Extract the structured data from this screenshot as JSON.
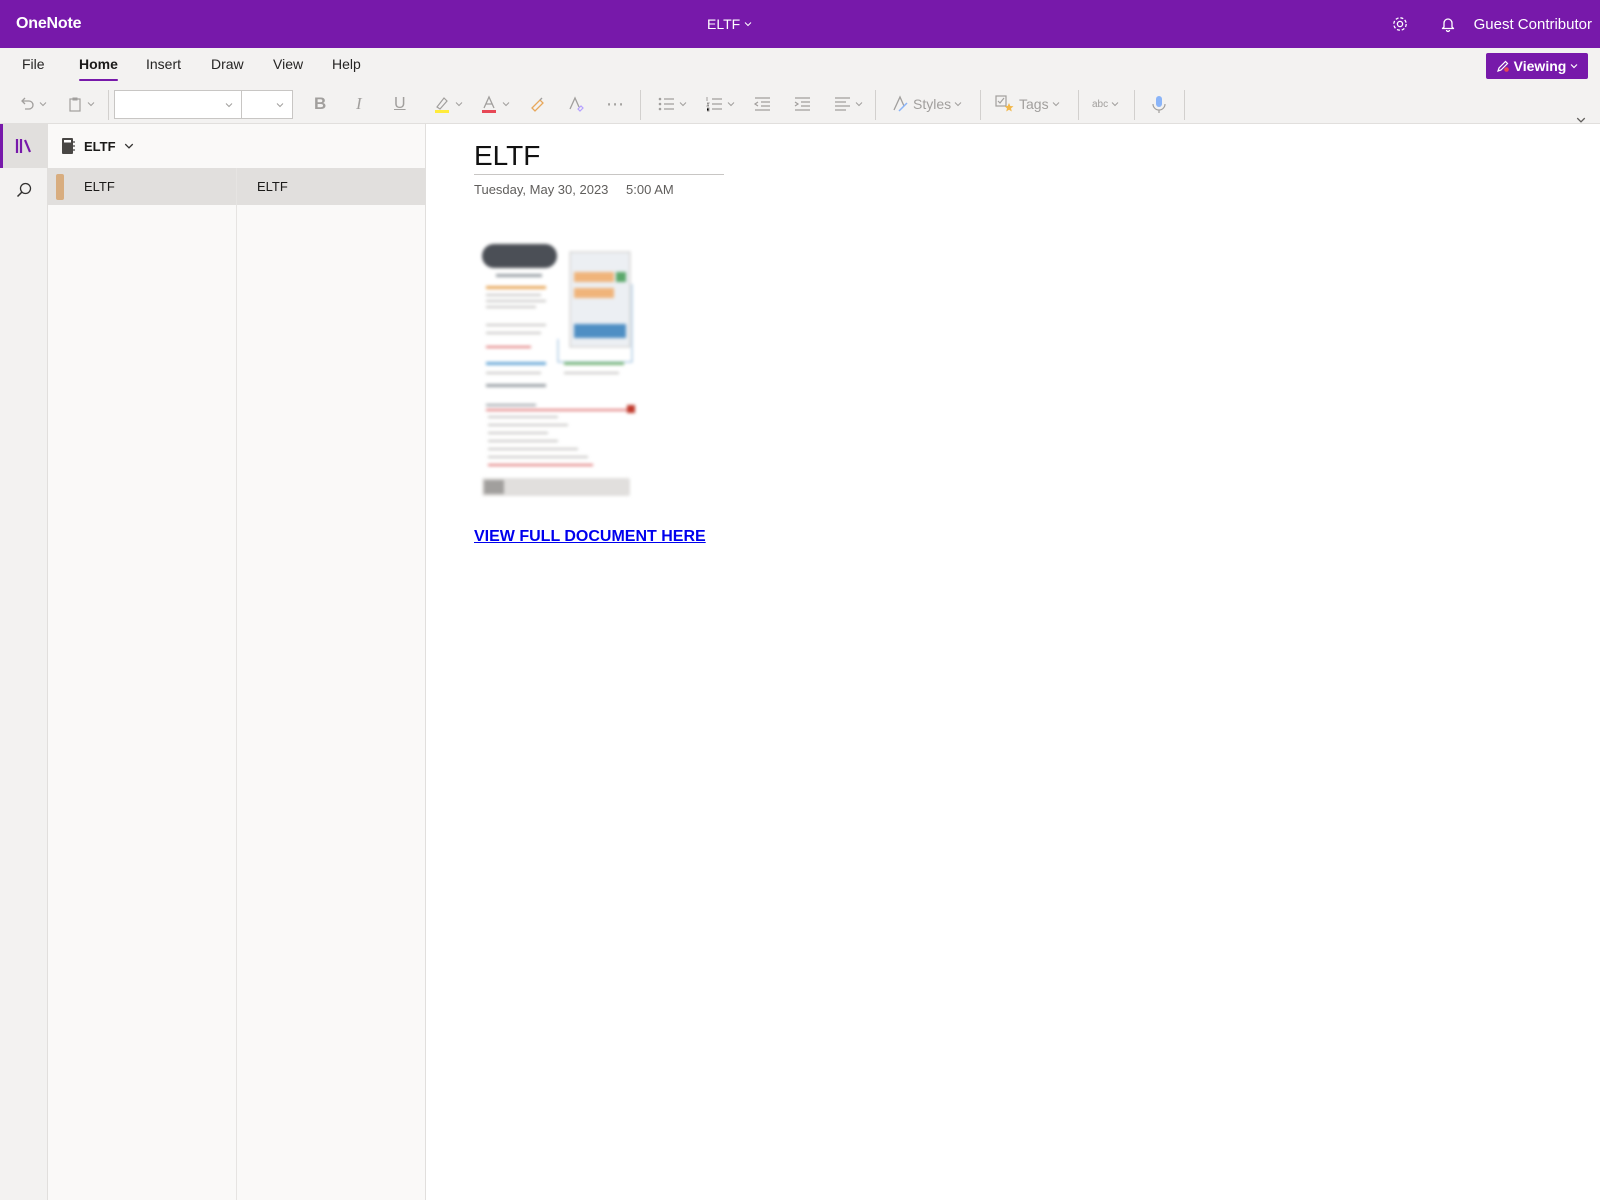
{
  "titlebar": {
    "app_name": "OneNote",
    "document_title": "ELTF",
    "user_name": "Guest Contributor",
    "icons": [
      "settings-icon",
      "notification-bell-icon"
    ]
  },
  "ribbon": {
    "tabs": [
      {
        "label": "File",
        "active": false
      },
      {
        "label": "Home",
        "active": true
      },
      {
        "label": "Insert",
        "active": false
      },
      {
        "label": "Draw",
        "active": false
      },
      {
        "label": "View",
        "active": false
      },
      {
        "label": "Help",
        "active": false
      }
    ],
    "mode_button": "Viewing",
    "toolbar": {
      "font_name": "",
      "font_size": "",
      "styles_label": "Styles",
      "tags_label": "Tags",
      "spelling_label": "abc"
    }
  },
  "notebook": {
    "name": "ELTF",
    "sections": [
      {
        "name": "ELTF",
        "color": "#d8ad7f",
        "selected": true
      }
    ],
    "pages": [
      {
        "name": "ELTF",
        "selected": true
      }
    ]
  },
  "page": {
    "title": "ELTF",
    "date": "Tuesday, May 30, 2023",
    "time": "5:00 AM",
    "link_text": "VIEW FULL DOCUMENT HERE"
  },
  "colors": {
    "brand": "#7719aa",
    "link": "#0000ee"
  }
}
